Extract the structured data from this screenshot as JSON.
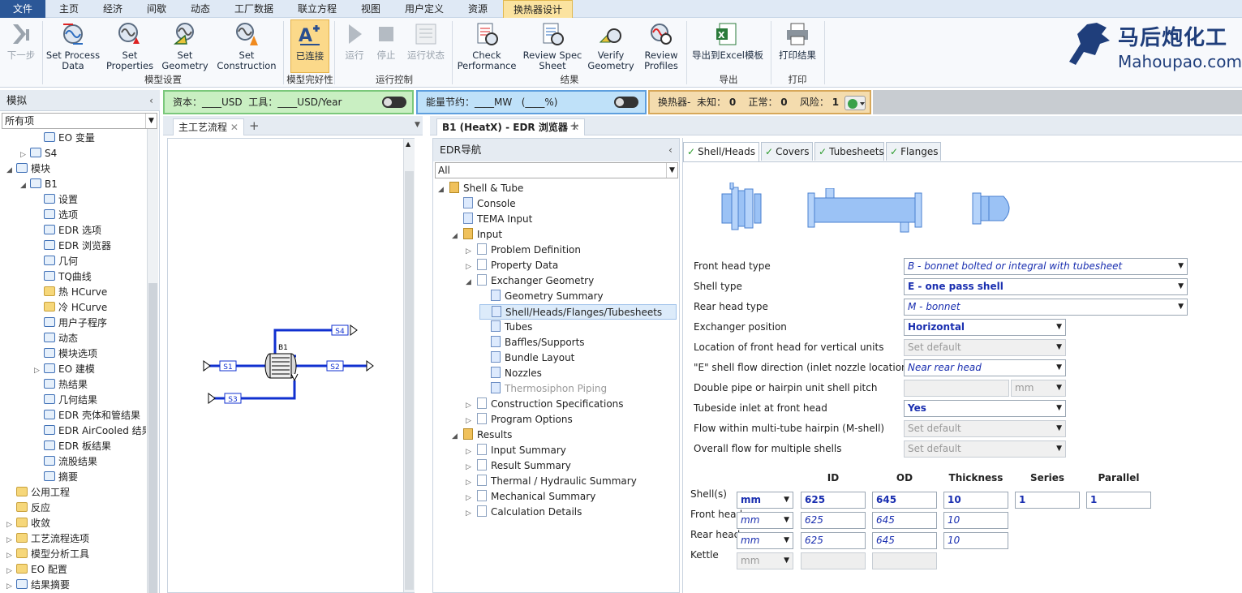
{
  "menu": {
    "items": [
      "文件",
      "主页",
      "经济",
      "间歇",
      "动态",
      "工厂数据",
      "联立方程",
      "视图",
      "用户定义",
      "资源",
      "换热器设计"
    ]
  },
  "ribbon": {
    "buttons": {
      "next": "下一步",
      "set_process": "Set Process\nData",
      "set_properties": "Set\nProperties",
      "set_geometry": "Set\nGeometry",
      "set_construction": "Set\nConstruction",
      "connected": "已连接",
      "run": "运行",
      "stop": "停止",
      "run_status": "运行状态",
      "check_performance": "Check\nPerformance",
      "review_spec": "Review Spec\nSheet",
      "verify_geometry": "Verify\nGeometry",
      "review_profiles": "Review\nProfiles",
      "export_excel": "导出到Excel模板",
      "print_results": "打印结果"
    },
    "groups": {
      "model_setup": "模型设置",
      "model_integrity": "模型完好性",
      "run_control": "运行控制",
      "results": "结果",
      "export": "导出",
      "print": "打印"
    }
  },
  "logo": {
    "title": "马后炮化工",
    "url": "Mahoupao.com"
  },
  "left": {
    "header": "模拟",
    "filter": "所有项",
    "tree": [
      {
        "label": "EO 变量",
        "level": 3
      },
      {
        "label": "S4",
        "level": 2,
        "exp": "▷"
      },
      {
        "label": "模块",
        "level": 1,
        "exp": "◢"
      },
      {
        "label": "B1",
        "level": 2,
        "exp": "◢"
      },
      {
        "label": "设置",
        "level": 3
      },
      {
        "label": "选项",
        "level": 3
      },
      {
        "label": "EDR 选项",
        "level": 3
      },
      {
        "label": "EDR 浏览器",
        "level": 3
      },
      {
        "label": "几何",
        "level": 3
      },
      {
        "label": "TQ曲线",
        "level": 3
      },
      {
        "label": "热 HCurve",
        "level": 3,
        "fold": true
      },
      {
        "label": "冷 HCurve",
        "level": 3,
        "fold": true
      },
      {
        "label": "用户子程序",
        "level": 3
      },
      {
        "label": "动态",
        "level": 3
      },
      {
        "label": "模块选项",
        "level": 3
      },
      {
        "label": "EO 建模",
        "level": 3,
        "exp": "▷"
      },
      {
        "label": "热结果",
        "level": 3
      },
      {
        "label": "几何结果",
        "level": 3
      },
      {
        "label": "EDR 壳体和管结果",
        "level": 3
      },
      {
        "label": "EDR AirCooled 结果",
        "level": 3
      },
      {
        "label": "EDR 板结果",
        "level": 3
      },
      {
        "label": "流股结果",
        "level": 3
      },
      {
        "label": "摘要",
        "level": 3
      },
      {
        "label": "公用工程",
        "level": 1,
        "fold": true
      },
      {
        "label": "反应",
        "level": 1,
        "fold": true
      },
      {
        "label": "收敛",
        "level": 1,
        "exp": "▷",
        "fold": true
      },
      {
        "label": "工艺流程选项",
        "level": 1,
        "exp": "▷",
        "fold": true
      },
      {
        "label": "模型分析工具",
        "level": 1,
        "exp": "▷",
        "fold": true
      },
      {
        "label": "EO 配置",
        "level": 1,
        "exp": "▷",
        "fold": true
      },
      {
        "label": "结果摘要",
        "level": 1,
        "exp": "▷"
      }
    ]
  },
  "status": {
    "capital": "资本：____USD",
    "utility": "工具：____USD/Year",
    "energy": "能量节约：____MW",
    "energy_pct": "(____%)",
    "exchangers": "换热器-",
    "unknown_lbl": "未知：",
    "unknown_val": "0",
    "normal_lbl": "正常：",
    "normal_val": "0",
    "risk_lbl": "风险：",
    "risk_val": "1"
  },
  "tabs": {
    "flowsheet": "主工艺流程",
    "edr": "B1 (HeatX) - EDR 浏览器",
    "add": "+"
  },
  "flowsheet": {
    "streams": [
      "S1",
      "S2",
      "S3",
      "S4"
    ],
    "block": "B1"
  },
  "edr": {
    "header": "EDR导航",
    "filter": "All",
    "tree": [
      {
        "label": "Shell & Tube",
        "level": 0,
        "exp": "◢",
        "icon": "book"
      },
      {
        "label": "Console",
        "level": 1,
        "icon": "page"
      },
      {
        "label": "TEMA Input",
        "level": 1,
        "icon": "page"
      },
      {
        "label": "Input",
        "level": 1,
        "exp": "◢",
        "icon": "book"
      },
      {
        "label": "Problem Definition",
        "level": 2,
        "exp": "▷",
        "icon": "doc"
      },
      {
        "label": "Property Data",
        "level": 2,
        "exp": "▷",
        "icon": "doc"
      },
      {
        "label": "Exchanger Geometry",
        "level": 2,
        "exp": "◢",
        "icon": "doc"
      },
      {
        "label": "Geometry Summary",
        "level": 3,
        "icon": "page"
      },
      {
        "label": "Shell/Heads/Flanges/Tubesheets",
        "level": 3,
        "icon": "page",
        "sel": true
      },
      {
        "label": "Tubes",
        "level": 3,
        "icon": "page"
      },
      {
        "label": "Baffles/Supports",
        "level": 3,
        "icon": "page"
      },
      {
        "label": "Bundle Layout",
        "level": 3,
        "icon": "page"
      },
      {
        "label": "Nozzles",
        "level": 3,
        "icon": "page"
      },
      {
        "label": "Thermosiphon Piping",
        "level": 3,
        "icon": "page",
        "dim": true
      },
      {
        "label": "Construction Specifications",
        "level": 2,
        "exp": "▷",
        "icon": "doc"
      },
      {
        "label": "Program Options",
        "level": 2,
        "exp": "▷",
        "icon": "doc"
      },
      {
        "label": "Results",
        "level": 1,
        "exp": "◢",
        "icon": "book"
      },
      {
        "label": "Input Summary",
        "level": 2,
        "exp": "▷",
        "icon": "doc"
      },
      {
        "label": "Result Summary",
        "level": 2,
        "exp": "▷",
        "icon": "doc"
      },
      {
        "label": "Thermal / Hydraulic Summary",
        "level": 2,
        "exp": "▷",
        "icon": "doc"
      },
      {
        "label": "Mechanical Summary",
        "level": 2,
        "exp": "▷",
        "icon": "doc"
      },
      {
        "label": "Calculation Details",
        "level": 2,
        "exp": "▷",
        "icon": "doc"
      }
    ]
  },
  "form": {
    "tabs": [
      "Shell/Heads",
      "Covers",
      "Tubesheets",
      "Flanges"
    ],
    "fields": [
      {
        "label": "Front head type",
        "value": "B - bonnet bolted or integral with tubesheet",
        "style": "i"
      },
      {
        "label": "Shell type",
        "value": "E - one pass shell",
        "style": "b"
      },
      {
        "label": "Rear head type",
        "value": "M - bonnet",
        "style": "i"
      },
      {
        "label": "Exchanger position",
        "value": "Horizontal",
        "style": "b"
      },
      {
        "label": "Location of front head for vertical units",
        "value": "Set default",
        "style": "dis"
      },
      {
        "label": "\"E\" shell flow direction (inlet nozzle location)",
        "value": "Near rear head",
        "style": "i"
      },
      {
        "label": "Double pipe or hairpin unit shell pitch",
        "value": "",
        "unit": "mm",
        "style": "dis"
      },
      {
        "label": "Tubeside inlet at front head",
        "value": "Yes",
        "style": "b"
      },
      {
        "label": "Flow within multi-tube hairpin (M-shell)",
        "value": "Set default",
        "style": "dis"
      },
      {
        "label": "Overall flow for multiple shells",
        "value": "Set default",
        "style": "dis"
      }
    ],
    "table": {
      "headers": [
        "ID",
        "OD",
        "Thickness",
        "Series",
        "Parallel"
      ],
      "rows": [
        {
          "label": "Shell(s)",
          "unit": "mm",
          "id": "625",
          "od": "645",
          "thk": "10",
          "series": "1",
          "parallel": "1",
          "style": "b"
        },
        {
          "label": "Front head",
          "unit": "mm",
          "id": "625",
          "od": "645",
          "thk": "10",
          "style": "i"
        },
        {
          "label": "Rear head",
          "unit": "mm",
          "id": "625",
          "od": "645",
          "thk": "10",
          "style": "i"
        },
        {
          "label": "Kettle",
          "unit": "mm",
          "id": "",
          "od": "",
          "style": "dis"
        }
      ]
    }
  }
}
